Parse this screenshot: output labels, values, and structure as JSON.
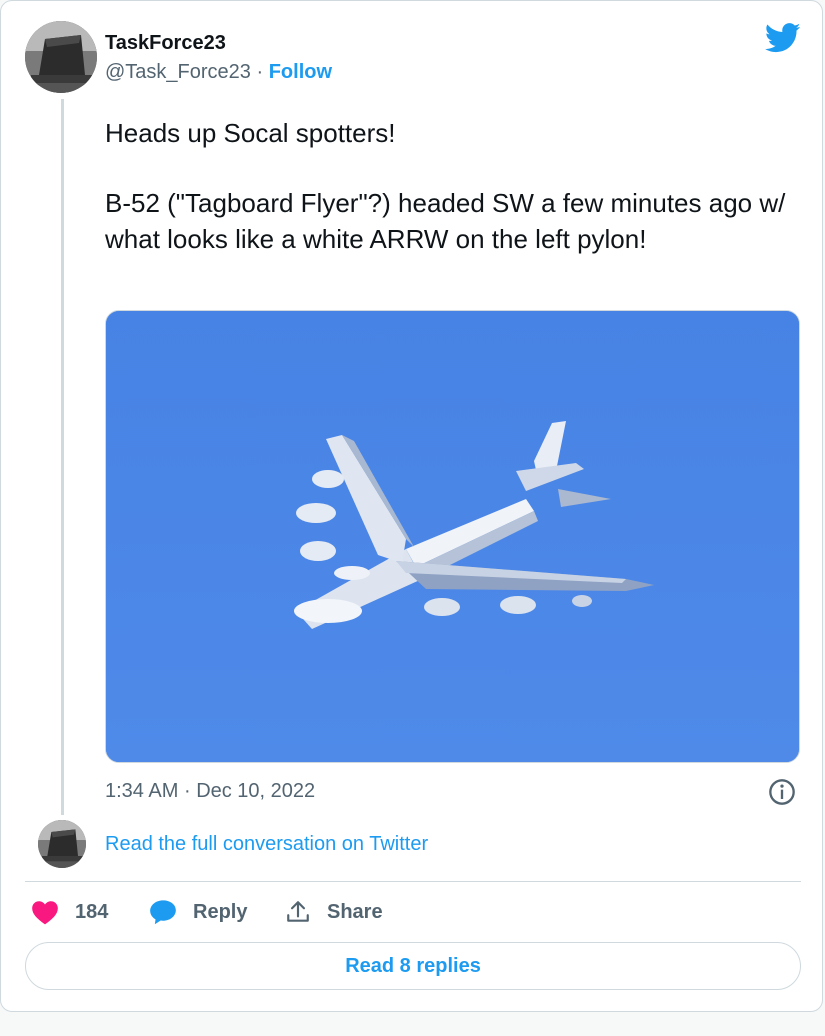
{
  "author": {
    "name": "TaskForce23",
    "handle": "@Task_Force23",
    "separator": "·",
    "follow_label": "Follow"
  },
  "tweet": {
    "paragraphs": [
      "Heads up Socal spotters!",
      "B-52 (\"Tagboard Flyer\"?) headed SW a few minutes ago w/ what looks like a white ARRW on the left pylon!"
    ],
    "time": "1:34 AM",
    "date": "Dec 10, 2022",
    "separator": "·"
  },
  "conversation_link": "Read the full conversation on Twitter",
  "actions": {
    "like_count": "184",
    "reply_label": "Reply",
    "share_label": "Share"
  },
  "read_replies_label": "Read 8 replies",
  "icons": {
    "brand": "twitter-bird-icon",
    "like": "heart-icon",
    "reply": "speech-bubble-icon",
    "share": "share-upload-icon",
    "info": "info-icon"
  },
  "colors": {
    "accent": "#1d9bf0",
    "like": "#f91880",
    "muted_text": "#536471",
    "border": "#cfd9de",
    "sky": "#4a86e6"
  }
}
